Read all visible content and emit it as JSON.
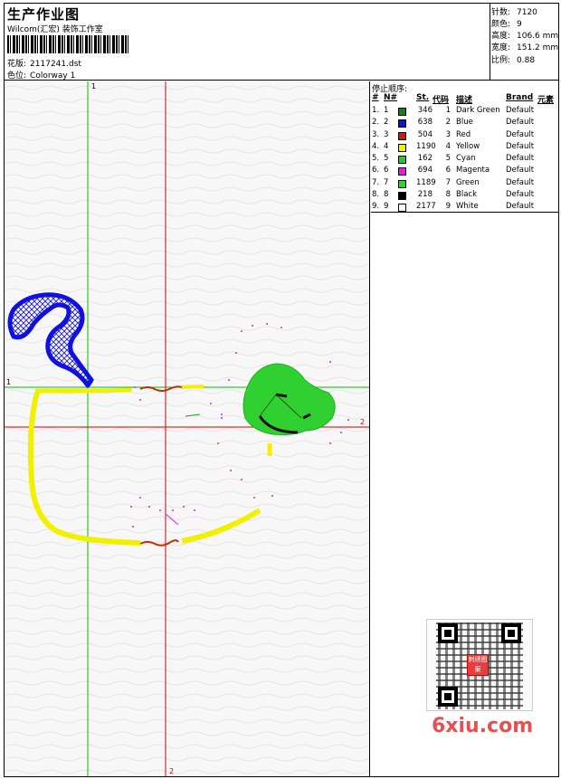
{
  "header": {
    "title": "生产作业图",
    "company": "Wilcom(汇宏) 装饰工作室",
    "design_label": "花版:",
    "design_value": "2117241.dst",
    "colorway_label": "色位:",
    "colorway_value": "Colorway 1"
  },
  "stats": [
    {
      "label": "针数:",
      "value": "7120"
    },
    {
      "label": "颜色:",
      "value": "9"
    },
    {
      "label": "高度:",
      "value": "106.6 mm"
    },
    {
      "label": "宽度:",
      "value": "151.2 mm"
    },
    {
      "label": "比例:",
      "value": "0.88"
    }
  ],
  "canvas": {
    "marker_top_1": "1",
    "marker_left_1": "1",
    "marker_right_2": "2",
    "marker_bottom_2": "2"
  },
  "sequence": {
    "title": "停止顺序:",
    "headers": {
      "hash": "#",
      "n": "N#",
      "st": "St.",
      "code": "代码",
      "desc": "描述",
      "brand": "Brand",
      "elem": "元素"
    },
    "rows": [
      {
        "hash": "1.",
        "n": "1",
        "color": "#138413",
        "st": "346",
        "code": "1",
        "desc": "Dark Green",
        "brand": "Default"
      },
      {
        "hash": "2.",
        "n": "2",
        "color": "#1010e0",
        "st": "638",
        "code": "2",
        "desc": "Blue",
        "brand": "Default"
      },
      {
        "hash": "3.",
        "n": "3",
        "color": "#e01010",
        "st": "504",
        "code": "3",
        "desc": "Red",
        "brand": "Default"
      },
      {
        "hash": "4.",
        "n": "4",
        "color": "#f0f000",
        "st": "1190",
        "code": "4",
        "desc": "Yellow",
        "brand": "Default"
      },
      {
        "hash": "5.",
        "n": "5",
        "color": "#20d020",
        "st": "162",
        "code": "5",
        "desc": "Cyan",
        "brand": "Default"
      },
      {
        "hash": "6.",
        "n": "6",
        "color": "#e020e0",
        "st": "694",
        "code": "6",
        "desc": "Magenta",
        "brand": "Default"
      },
      {
        "hash": "7.",
        "n": "7",
        "color": "#20e020",
        "st": "1189",
        "code": "7",
        "desc": "Green",
        "brand": "Default"
      },
      {
        "hash": "8.",
        "n": "8",
        "color": "#000000",
        "st": "218",
        "code": "8",
        "desc": "Black",
        "brand": "Default"
      },
      {
        "hash": "9.",
        "n": "9",
        "color": "#ffffff",
        "st": "2177",
        "code": "9",
        "desc": "White",
        "brand": "Default"
      }
    ]
  },
  "watermark": {
    "site": "6xiu.com",
    "seal_text": "刺绣图案"
  },
  "colors": {
    "guide_green": "#00c000",
    "guide_red": "#d00000",
    "yellow_stitch": "#f0f000",
    "blue_stitch": "#1010e0",
    "green_fill": "#30d030"
  }
}
